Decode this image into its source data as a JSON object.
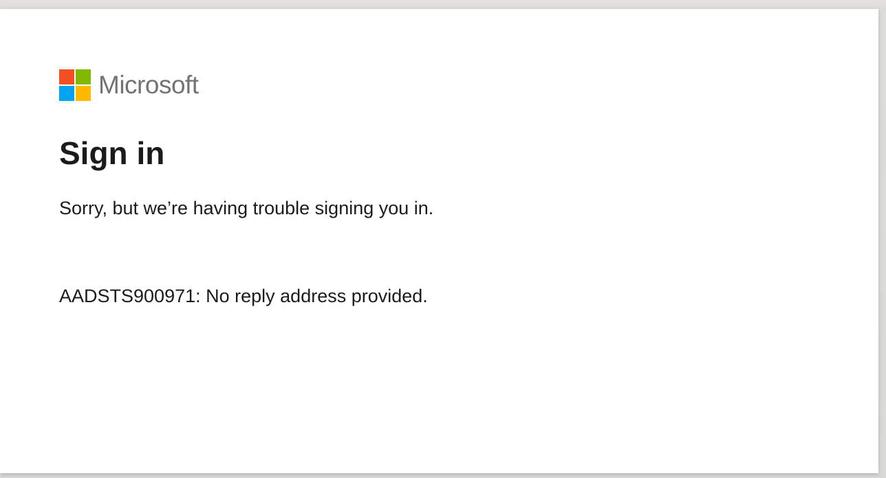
{
  "brand": {
    "name": "Microsoft",
    "colors": {
      "red": "#f25022",
      "green": "#7fba00",
      "blue": "#00a4ef",
      "yellow": "#ffb900",
      "text": "#737373"
    }
  },
  "page": {
    "title": "Sign in",
    "message": "Sorry, but we’re having trouble signing you in.",
    "error": "AADSTS900971: No reply address provided."
  }
}
